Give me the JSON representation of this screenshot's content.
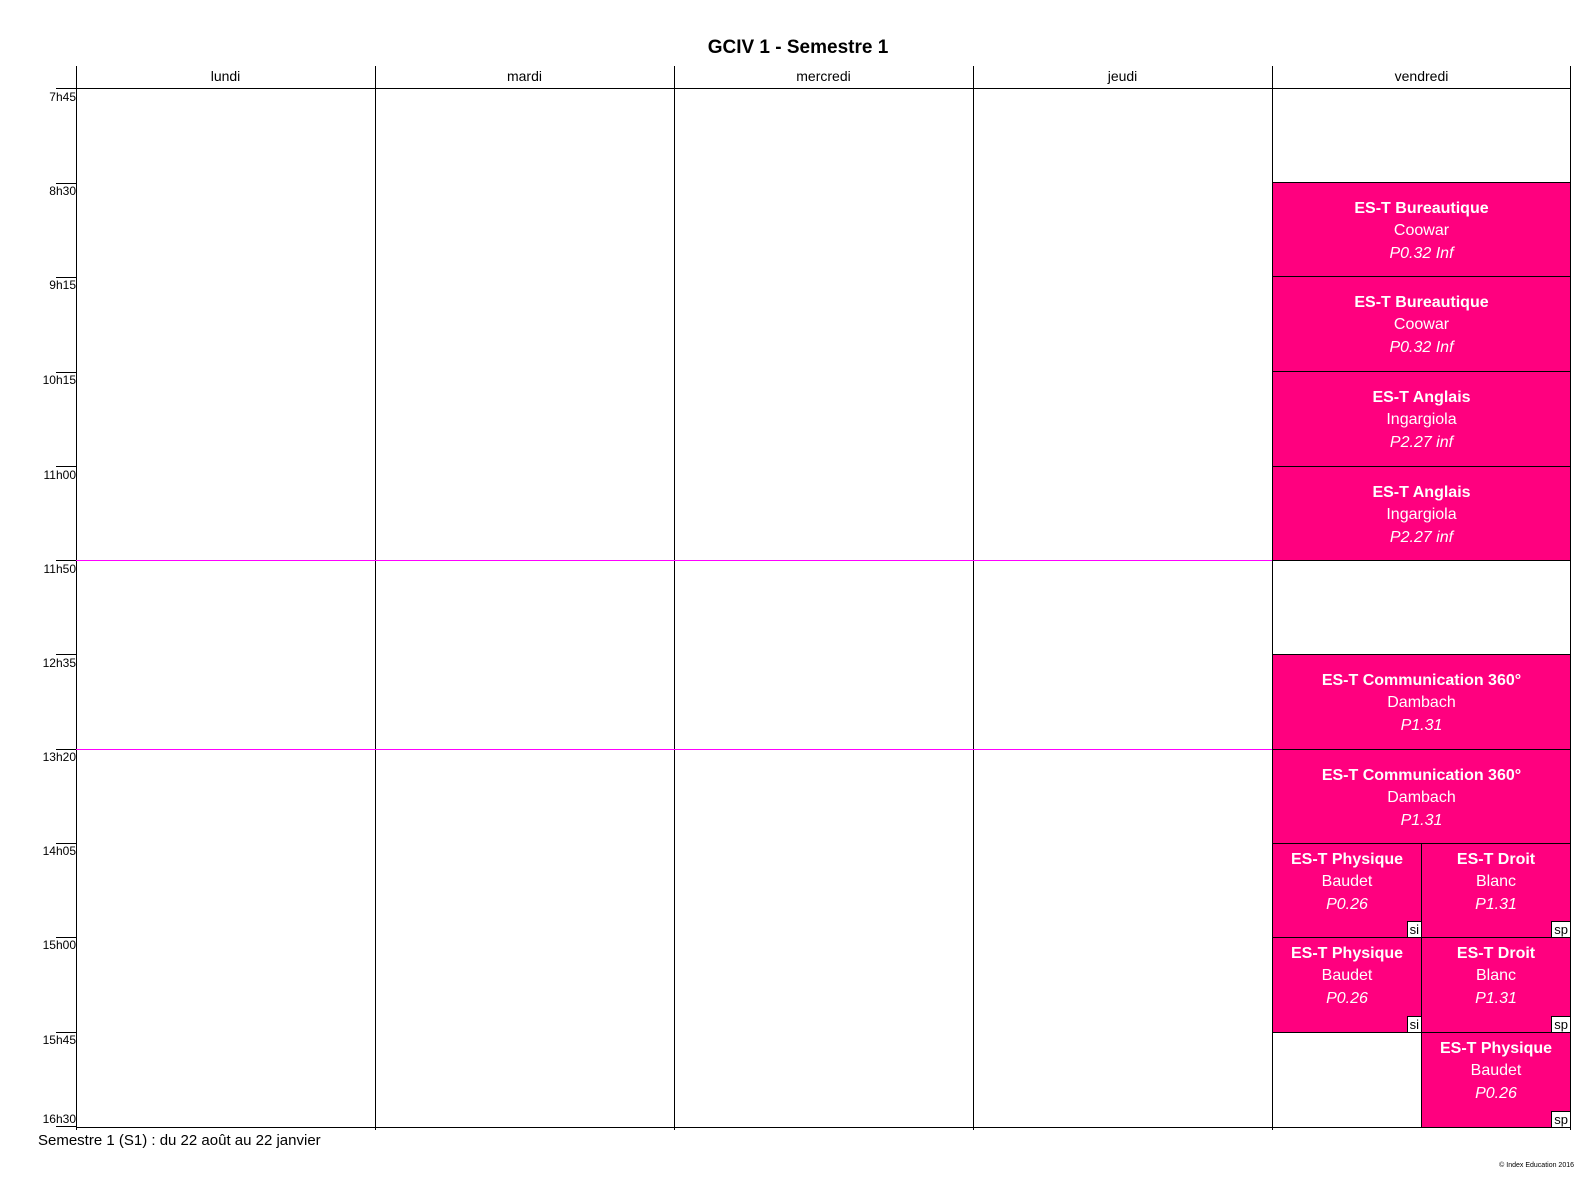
{
  "title": "GCIV 1 - Semestre 1",
  "days": [
    "lundi",
    "mardi",
    "mercredi",
    "jeudi",
    "vendredi"
  ],
  "times": [
    "7h45",
    "8h30",
    "9h15",
    "10h15",
    "11h00",
    "11h50",
    "12h35",
    "13h20",
    "14h05",
    "15h00",
    "15h45",
    "16h30"
  ],
  "events": [
    {
      "name": "ES-T Bureautique",
      "teacher": "Coowar",
      "room": "P0.32 Inf",
      "tag": ""
    },
    {
      "name": "ES-T Bureautique",
      "teacher": "Coowar",
      "room": "P0.32 Inf",
      "tag": ""
    },
    {
      "name": "ES-T Anglais",
      "teacher": "Ingargiola",
      "room": "P2.27 inf",
      "tag": ""
    },
    {
      "name": "ES-T Anglais",
      "teacher": "Ingargiola",
      "room": "P2.27 inf",
      "tag": ""
    },
    {
      "name": "ES-T Communication 360°",
      "teacher": "Dambach",
      "room": "P1.31",
      "tag": ""
    },
    {
      "name": "ES-T Communication 360°",
      "teacher": "Dambach",
      "room": "P1.31",
      "tag": ""
    },
    {
      "name": "ES-T Physique",
      "teacher": "Baudet",
      "room": "P0.26",
      "tag": "si"
    },
    {
      "name": "ES-T Droit",
      "teacher": "Blanc",
      "room": "P1.31",
      "tag": "sp"
    },
    {
      "name": "ES-T Physique",
      "teacher": "Baudet",
      "room": "P0.26",
      "tag": "si"
    },
    {
      "name": "ES-T Droit",
      "teacher": "Blanc",
      "room": "P1.31",
      "tag": "sp"
    },
    {
      "name": "ES-T Physique",
      "teacher": "Baudet",
      "room": "P0.26",
      "tag": "sp"
    }
  ],
  "footer": "Semestre 1 (S1) : du 22 août au 22 janvier",
  "copyright": "© Index Education 2016",
  "colors": {
    "event": "#ff007f",
    "break_line": "#ff00ff"
  }
}
